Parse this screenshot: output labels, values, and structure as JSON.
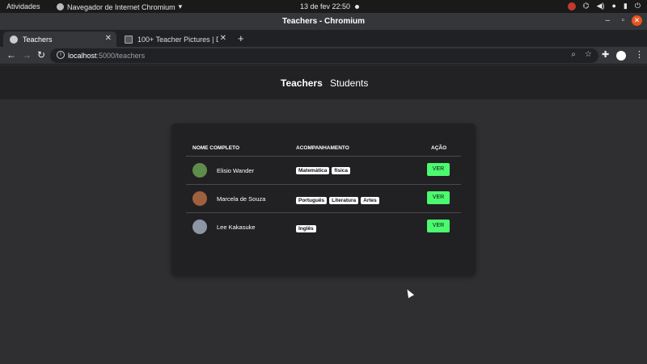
{
  "system_bar": {
    "activities": "Atividades",
    "app_name": "Navegador de Internet Chromium",
    "clock": "13 de fev  22:50"
  },
  "window": {
    "title": "Teachers - Chromium"
  },
  "tabs": [
    {
      "label": "Teachers",
      "active": true
    },
    {
      "label": "100+ Teacher Pictures | Do",
      "active": false
    }
  ],
  "address_bar": {
    "host": "localhost",
    "path": ":5000/teachers"
  },
  "site_nav": {
    "teachers": "Teachers",
    "students": "Students"
  },
  "table": {
    "headers": {
      "name": "NOME COMPLETO",
      "subjects": "ACOMPANHAMENTO",
      "action": "AÇÃO"
    },
    "rows": [
      {
        "name": "Elisio Wander",
        "tags": [
          "Matemática",
          "física"
        ],
        "action": "VER"
      },
      {
        "name": "Marcela de Souza",
        "tags": [
          "Português",
          "Literatura",
          "Artes"
        ],
        "action": "VER"
      },
      {
        "name": "Lee Kakasuke",
        "tags": [
          "Inglês"
        ],
        "action": "VER"
      }
    ]
  },
  "colors": {
    "accent_button": "#4bfa6e",
    "page_bg": "#2f2e31",
    "card_bg": "#212023"
  }
}
